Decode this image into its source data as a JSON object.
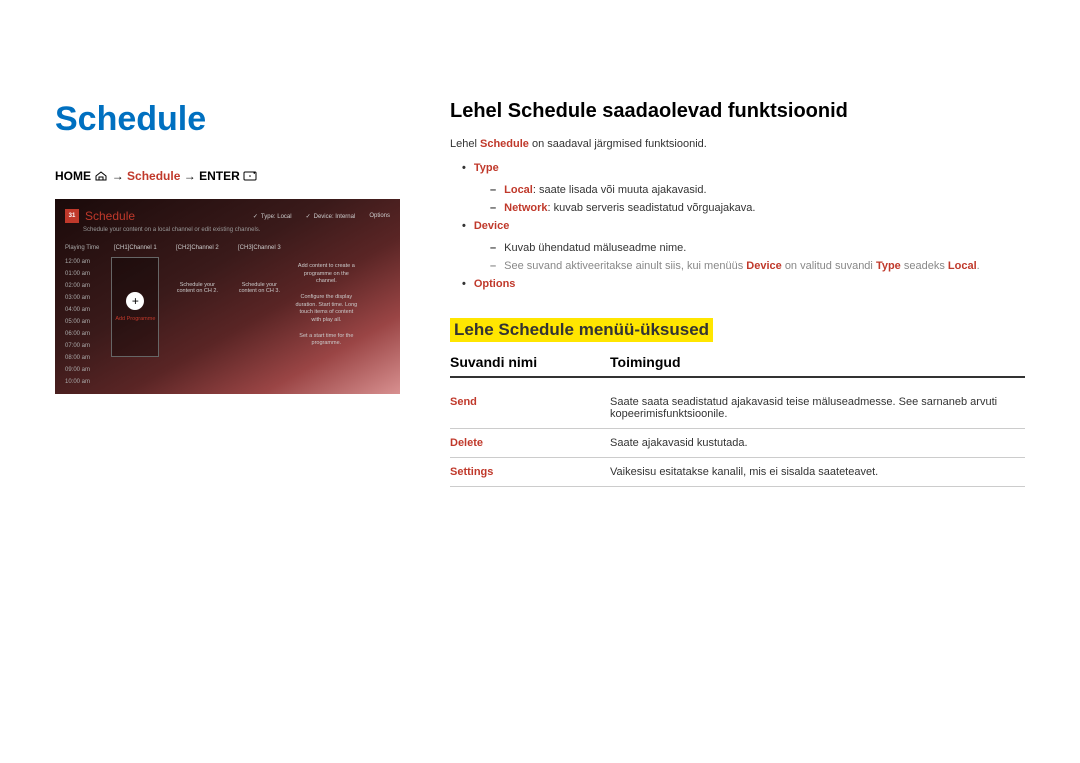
{
  "left": {
    "title": "Schedule",
    "breadcrumb": {
      "home": "HOME",
      "schedule": "Schedule",
      "enter": "ENTER",
      "arrow": "→"
    },
    "preview": {
      "cal_num": "31",
      "title": "Schedule",
      "top_type": "Type: Local",
      "top_device": "Device: Internal",
      "top_options": "Options",
      "subtitle": "Schedule your content on a local channel or edit existing channels.",
      "time_label": "Playing Time",
      "times": [
        "12:00 am",
        "01:00 am",
        "02:00 am",
        "03:00 am",
        "04:00 am",
        "05:00 am",
        "06:00 am",
        "07:00 am",
        "08:00 am",
        "09:00 am",
        "10:00 am"
      ],
      "ch1": "[CH1]Channel 1",
      "ch2": "[CH2]Channel 2",
      "ch3": "[CH3]Channel 3",
      "add_label": "Add Programme",
      "ch2_desc": "Schedule your content on CH 2.",
      "ch3_desc": "Schedule your content on CH 3.",
      "side1": "Add content to create a programme on the channel.",
      "side2": "Configure the display duration. Start time. Long touch items of content with play all.",
      "side3": "Set a start time for the programme."
    }
  },
  "right": {
    "section_title": "Lehel Schedule saadaolevad funktsioonid",
    "intro_pre": "Lehel",
    "intro_hl": "Schedule",
    "intro_post": "on saadaval järgmised funktsioonid.",
    "items": {
      "type": {
        "label": "Type",
        "local_label": "Local",
        "local_text": ": saate lisada või muuta ajakavasid.",
        "network_label": "Network",
        "network_text": ": kuvab serveris seadistatud võrguajakava."
      },
      "device": {
        "label": "Device",
        "sub_text": "Kuvab ühendatud mäluseadme nime.",
        "note_pre": "See suvand aktiveeritakse ainult siis, kui menüüs",
        "note_hl1": "Device",
        "note_mid": "on valitud suvandi",
        "note_hl2": "Type",
        "note_mid2": "seadeks",
        "note_hl3": "Local",
        "note_end": "."
      },
      "options": {
        "label": "Options"
      }
    },
    "subsection_title": "Lehe Schedule menüü-üksused",
    "table": {
      "header_name": "Suvandi nimi",
      "header_action": "Toimingud",
      "rows": [
        {
          "name": "Send",
          "action": "Saate saata seadistatud ajakavasid teise mäluseadmesse. See sarnaneb arvuti kopeerimisfunktsioonile."
        },
        {
          "name": "Delete",
          "action": "Saate ajakavasid kustutada."
        },
        {
          "name": "Settings",
          "action": "Vaikesisu esitatakse kanalil, mis ei sisalda saateteavet."
        }
      ]
    }
  }
}
